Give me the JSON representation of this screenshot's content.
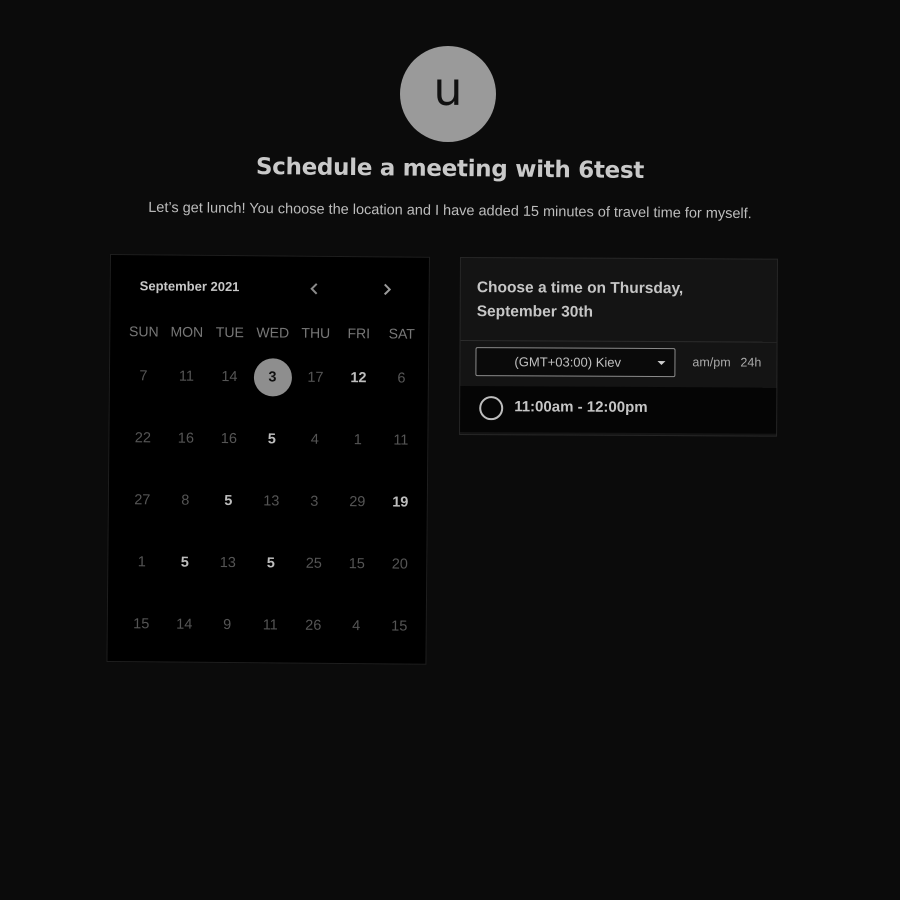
{
  "host": {
    "avatar_letter": "u",
    "title": "Schedule a meeting with 6test",
    "description": "Let’s get lunch! You choose the location and I have added 15 minutes of travel time for myself."
  },
  "calendar": {
    "month_label": "September 2021",
    "prev_icon": "chevron-left-icon",
    "next_icon": "chevron-right-icon",
    "weekdays": [
      "SUN",
      "MON",
      "TUE",
      "WED",
      "THU",
      "FRI",
      "SAT"
    ],
    "weeks": [
      [
        {
          "d": "7",
          "a": false
        },
        {
          "d": "11",
          "a": false
        },
        {
          "d": "14",
          "a": false
        },
        {
          "d": "3",
          "a": true,
          "sel": true
        },
        {
          "d": "17",
          "a": false
        },
        {
          "d": "12",
          "a": true
        },
        {
          "d": "6",
          "a": false
        }
      ],
      [
        {
          "d": "22",
          "a": false
        },
        {
          "d": "16",
          "a": false
        },
        {
          "d": "16",
          "a": false
        },
        {
          "d": "5",
          "a": true
        },
        {
          "d": "4",
          "a": false
        },
        {
          "d": "1",
          "a": false
        },
        {
          "d": "11",
          "a": false
        }
      ],
      [
        {
          "d": "27",
          "a": false
        },
        {
          "d": "8",
          "a": false
        },
        {
          "d": "5",
          "a": true
        },
        {
          "d": "13",
          "a": false
        },
        {
          "d": "3",
          "a": false
        },
        {
          "d": "29",
          "a": false
        },
        {
          "d": "19",
          "a": true
        }
      ],
      [
        {
          "d": "1",
          "a": false
        },
        {
          "d": "5",
          "a": true
        },
        {
          "d": "13",
          "a": false
        },
        {
          "d": "5",
          "a": true
        },
        {
          "d": "25",
          "a": false
        },
        {
          "d": "15",
          "a": false
        },
        {
          "d": "20",
          "a": false
        }
      ],
      [
        {
          "d": "15",
          "a": false
        },
        {
          "d": "14",
          "a": false
        },
        {
          "d": "9",
          "a": false
        },
        {
          "d": "11",
          "a": false
        },
        {
          "d": "26",
          "a": false
        },
        {
          "d": "4",
          "a": false
        },
        {
          "d": "15",
          "a": false
        }
      ]
    ]
  },
  "time_panel": {
    "heading": "Choose a time on Thursday, September 30th",
    "timezone": "(GMT+03:00) Kiev",
    "format_ampm": "am/pm",
    "format_24h": "24h",
    "slots": [
      {
        "label": "11:00am - 12:00pm"
      }
    ]
  },
  "colors": {
    "background": "#0b0b0b",
    "selected_day": "#8e8e8e",
    "avatar": "#9a9a9a"
  }
}
